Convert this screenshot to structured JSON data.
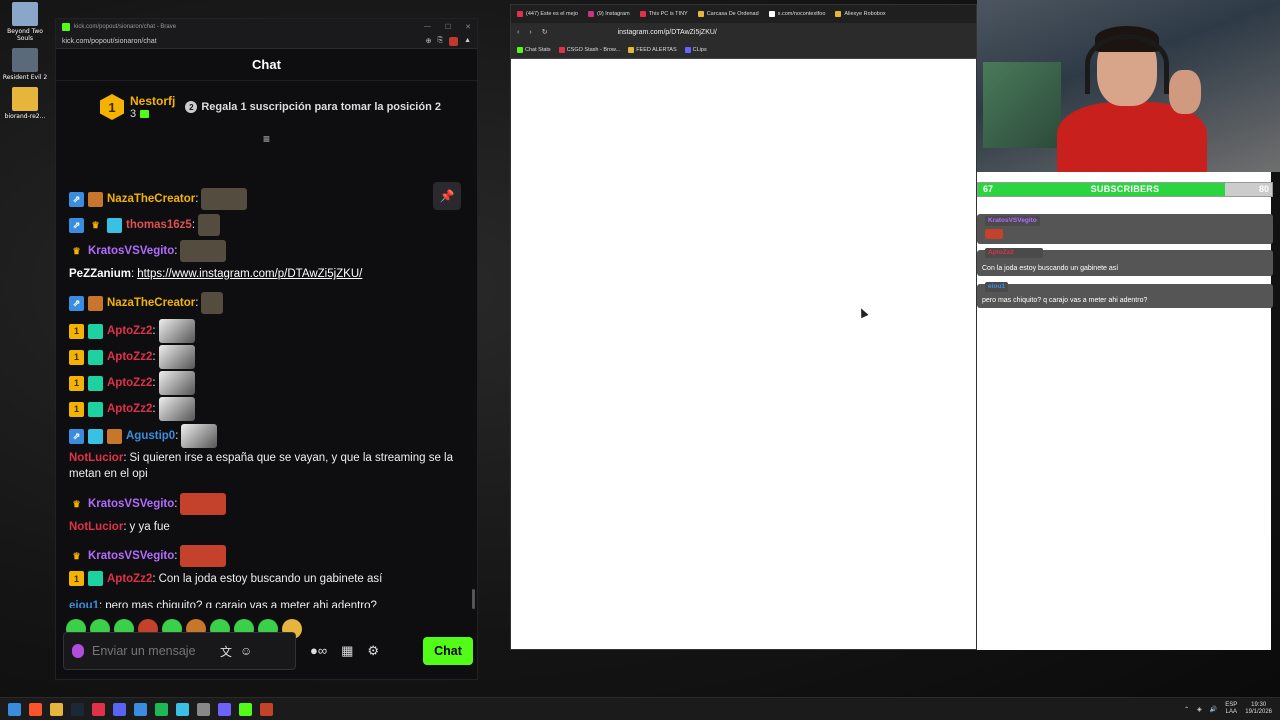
{
  "desktop": {
    "icons": [
      {
        "label": "Beyond Two Souls",
        "color": "#8aa7c9"
      },
      {
        "label": "Resident Evil 2",
        "color": "#5a6a7a"
      },
      {
        "label": "biorand-re2...",
        "color": "#e6b53c"
      }
    ]
  },
  "chat_window": {
    "title": "kick.com/popout/sionaron/chat - Brave",
    "url": "kick.com/popout/sionaron/chat",
    "header": "Chat",
    "pinned": {
      "rank": "1",
      "user": "Nestorfj",
      "count": "3",
      "cta_num": "2",
      "cta_text": "Regala 1 suscripción para tomar la posición 2"
    },
    "messages": [
      {
        "badges": [
          "blue",
          "chest"
        ],
        "user": "NazaTheCreator",
        "user_color": "#f5b301",
        "text": "",
        "emote": "norm"
      },
      {
        "badges": [
          "blue",
          "crown",
          "cube"
        ],
        "user": "thomas16z5",
        "user_color": "#e05050",
        "text": "",
        "emote": "sm"
      },
      {
        "badges": [
          "crown"
        ],
        "user": "KratosVSVegito",
        "user_color": "#b36bff",
        "text": "",
        "emote": "norm"
      },
      {
        "badges": [],
        "user": "PeZZanium",
        "user_color": "#ffffff",
        "text": "",
        "link": "https://www.instagram.com/p/DTAwZi5jZKU/"
      },
      {
        "badges": [
          "blue",
          "chest"
        ],
        "user": "NazaTheCreator",
        "user_color": "#f5b301",
        "text": "",
        "emote": "sm"
      },
      {
        "badges": [
          "one",
          "gift"
        ],
        "user": "AptoZz2",
        "user_color": "#e0314b",
        "text": "",
        "emote": "bw"
      },
      {
        "badges": [
          "one",
          "gift"
        ],
        "user": "AptoZz2",
        "user_color": "#e0314b",
        "text": "",
        "emote": "bw"
      },
      {
        "badges": [
          "one",
          "gift"
        ],
        "user": "AptoZz2",
        "user_color": "#e0314b",
        "text": "",
        "emote": "bw"
      },
      {
        "badges": [
          "one",
          "gift"
        ],
        "user": "AptoZz2",
        "user_color": "#e0314b",
        "text": "",
        "emote": "bw"
      },
      {
        "badges": [
          "blue",
          "cube",
          "chest"
        ],
        "user": "Agustip0",
        "user_color": "#3a8dde",
        "text": "",
        "emote": "bw"
      },
      {
        "badges": [],
        "user": "NotLucior",
        "user_color": "#e0314b",
        "text": "Si quieren irse a españa que se vayan, y que la streaming se la metan en el opi"
      },
      {
        "badges": [
          "crown"
        ],
        "user": "KratosVSVegito",
        "user_color": "#b36bff",
        "text": "",
        "emote": "red"
      },
      {
        "badges": [],
        "user": "NotLucior",
        "user_color": "#e0314b",
        "text": "y ya fue"
      },
      {
        "badges": [
          "crown"
        ],
        "user": "KratosVSVegito",
        "user_color": "#b36bff",
        "text": "",
        "emote": "red"
      },
      {
        "badges": [
          "one",
          "gift"
        ],
        "user": "AptoZz2",
        "user_color": "#e0314b",
        "text": "Con la joda estoy buscando un gabinete así"
      },
      {
        "badges": [],
        "user": "eiou1",
        "user_color": "#3a8dde",
        "text": "pero mas chiquito? q carajo vas a meter ahi adentro?"
      }
    ],
    "emote_bar_colors": [
      "#3bd04a",
      "#3bd04a",
      "#3bd04a",
      "#c4422c",
      "#3bd04a",
      "#c7762c",
      "#3bd04a",
      "#3bd04a",
      "#3bd04a",
      "#e6b53c"
    ],
    "input_placeholder": "Enviar un mensaje",
    "send_label": "Chat",
    "accent": "#53fc18"
  },
  "browser": {
    "tabs": [
      {
        "label": "(447) Este es el mejo",
        "color": "#e0314b"
      },
      {
        "label": "(9) Instagram",
        "color": "#c13584"
      },
      {
        "label": "This PC is TINY",
        "color": "#e0314b"
      },
      {
        "label": "Carcasa De Ordenad",
        "color": "#e6b53c"
      },
      {
        "label": "x.com/nocontextfoo",
        "color": "#ffffff"
      },
      {
        "label": "Aliexye Robobox",
        "color": "#e6b53c"
      }
    ],
    "url": "instagram.com/p/DTAwZi5jZKU/",
    "bookmarks": [
      {
        "label": "Chat Stats",
        "color": "#53fc18"
      },
      {
        "label": "CSGO Stash - Brow...",
        "color": "#e0314b"
      },
      {
        "label": "FEED ALERTAS",
        "color": "#e6b53c"
      },
      {
        "label": "CLips",
        "color": "#6c63ff"
      }
    ]
  },
  "overlay": {
    "sub_current": "67",
    "sub_label": "SUBSCRIBERS",
    "sub_max": "80",
    "sub_progress": 0.84,
    "messages": [
      {
        "user": "KratosVSVegito",
        "text": ""
      },
      {
        "user": "AptoZz2",
        "text": "Con la joda estoy buscando un gabinete así"
      },
      {
        "user": "eiou1",
        "text": "pero mas chiquito? q carajo vas a meter ahi adentro?"
      }
    ]
  },
  "taskbar": {
    "lang_top": "ESP",
    "lang_bottom": "LAA",
    "time": "19:30",
    "date": "19/1/2026"
  }
}
